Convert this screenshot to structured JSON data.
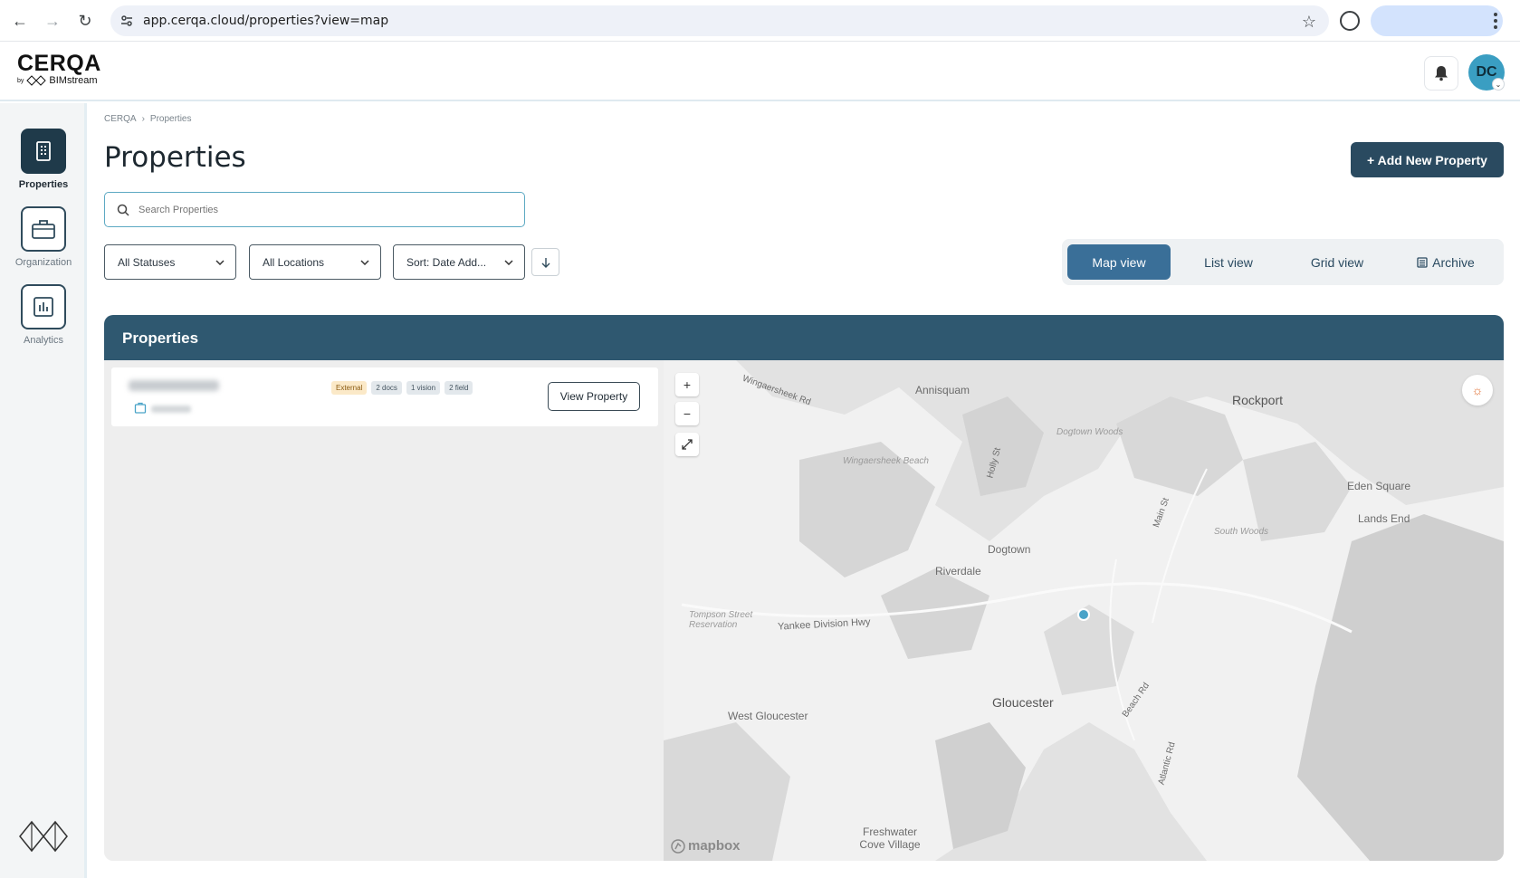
{
  "browser": {
    "url": "app.cerqa.cloud/properties?view=map"
  },
  "brand": {
    "name": "CERQA",
    "by": "by",
    "sub": "BIMstream"
  },
  "user": {
    "initials": "DC"
  },
  "sidebar": {
    "items": [
      {
        "label": "Properties",
        "icon": "building-icon",
        "active": true
      },
      {
        "label": "Organization",
        "icon": "briefcase-icon",
        "active": false
      },
      {
        "label": "Analytics",
        "icon": "bar-chart-icon",
        "active": false
      }
    ]
  },
  "breadcrumb": {
    "root": "CERQA",
    "sep": "›",
    "current": "Properties"
  },
  "page": {
    "title": "Properties",
    "add_button": "+ Add New Property"
  },
  "search": {
    "placeholder": "Search Properties"
  },
  "filters": {
    "status": "All Statuses",
    "location": "All Locations",
    "sort": "Sort: Date Add..."
  },
  "views": {
    "map": "Map view",
    "list": "List view",
    "grid": "Grid view",
    "archive": "Archive",
    "active": "map"
  },
  "panel": {
    "title": "Properties",
    "card": {
      "tags": [
        "External",
        "2 docs",
        "1 vision",
        "2 field"
      ],
      "view_button": "View Property"
    }
  },
  "map": {
    "labels": {
      "rockport": "Rockport",
      "annisquam": "Annisquam",
      "dogtown_woods": "Dogtown Woods",
      "wingaersheek_rd": "Wingaersheek Rd",
      "wingaersheek_beach": "Wingaersheek Beach",
      "holly_st": "Holly St",
      "main_st": "Main St",
      "eden_square": "Eden Square",
      "lands_end": "Lands End",
      "south_woods": "South Woods",
      "dogtown": "Dogtown",
      "riverdale": "Riverdale",
      "tompson": "Tompson Street Reservation",
      "yankee": "Yankee Division Hwy",
      "gloucester": "Gloucester",
      "west_gloucester": "West Gloucester",
      "beach_rd": "Beach Rd",
      "atlantic_rd": "Atlantic Rd",
      "freshwater": "Freshwater Cove Village"
    },
    "attribution": "mapbox"
  }
}
